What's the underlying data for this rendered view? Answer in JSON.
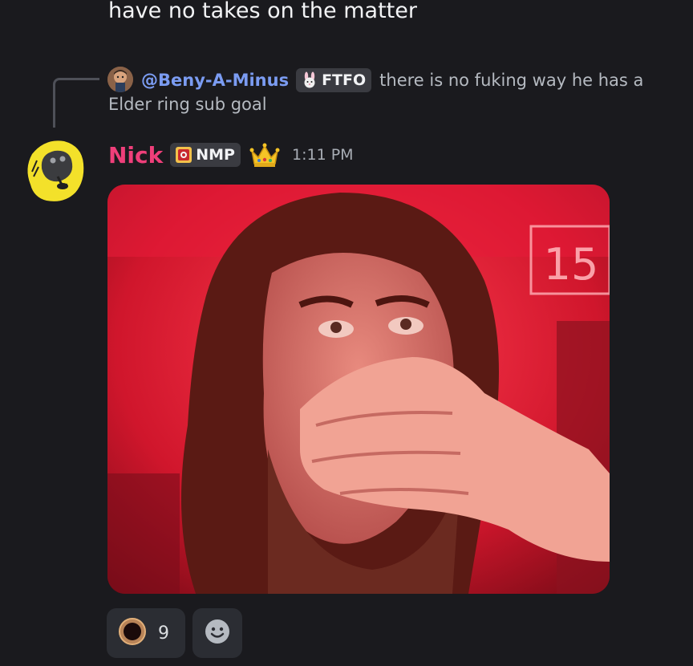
{
  "previous_message": {
    "text": "have no takes on the matter"
  },
  "reply": {
    "username": "@Beny-A-Minus",
    "tag": {
      "label": "FTFO",
      "icon": "bunny-icon"
    },
    "text_line1": "there is no fuking way he has a",
    "text_line2": "Elder ring sub goal"
  },
  "message": {
    "username": "Nick",
    "username_color": "#ef3f7a",
    "tag": {
      "label": "NMP",
      "icon": "shield-badge-icon"
    },
    "role_icon": "crown-icon",
    "timestamp": "1:11 PM",
    "media": {
      "label": "15"
    }
  },
  "reactions": [
    {
      "icon": "ring-emoji-icon",
      "count": "9"
    },
    {
      "icon": "add-reaction-smiley-icon"
    }
  ]
}
